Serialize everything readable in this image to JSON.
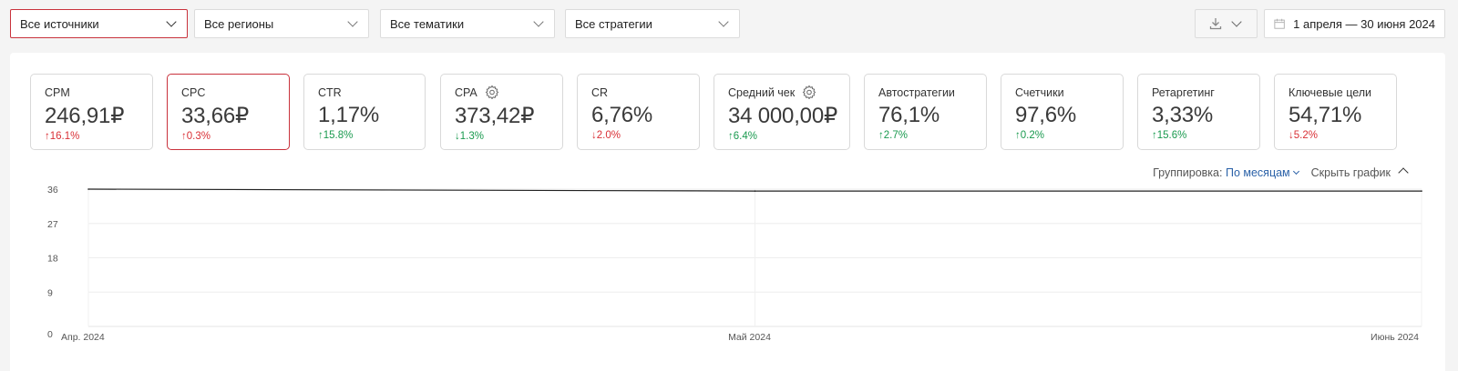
{
  "filters": [
    {
      "label": "Все источники"
    },
    {
      "label": "Все регионы"
    },
    {
      "label": "Все тематики"
    },
    {
      "label": "Все стратегии"
    }
  ],
  "date_range": "1 апреля — 30 июня 2024",
  "metrics": [
    {
      "name": "CPM",
      "value": "246,91₽",
      "delta": "16.1%",
      "dir": "up",
      "color": "down",
      "gear": false
    },
    {
      "name": "CPC",
      "value": "33,66₽",
      "delta": "0.3%",
      "dir": "up",
      "color": "down",
      "gear": false
    },
    {
      "name": "CTR",
      "value": "1,17%",
      "delta": "15.8%",
      "dir": "up",
      "color": "up",
      "gear": false
    },
    {
      "name": "CPA",
      "value": "373,42₽",
      "delta": "1.3%",
      "dir": "down",
      "color": "up",
      "gear": true
    },
    {
      "name": "CR",
      "value": "6,76%",
      "delta": "2.0%",
      "dir": "down",
      "color": "down",
      "gear": false
    },
    {
      "name": "Средний чек",
      "value": "34 000,00₽",
      "delta": "6.4%",
      "dir": "up",
      "color": "up",
      "gear": true
    },
    {
      "name": "Автостратегии",
      "value": "76,1%",
      "delta": "2.7%",
      "dir": "up",
      "color": "up",
      "gear": false
    },
    {
      "name": "Счетчики",
      "value": "97,6%",
      "delta": "0.2%",
      "dir": "up",
      "color": "up",
      "gear": false
    },
    {
      "name": "Ретаргетинг",
      "value": "3,33%",
      "delta": "15.6%",
      "dir": "up",
      "color": "up",
      "gear": false
    },
    {
      "name": "Ключевые цели",
      "value": "54,71%",
      "delta": "5.2%",
      "dir": "down",
      "color": "down",
      "gear": false
    }
  ],
  "grouping": {
    "label": "Группировка:",
    "value": "По месяцам"
  },
  "hide_chart": "Скрыть график",
  "chart_data": {
    "type": "line",
    "x": [
      "Апр. 2024",
      "Май 2024",
      "Июнь 2024"
    ],
    "series": [
      {
        "values": [
          36.0,
          35.5,
          35.5
        ]
      }
    ],
    "yticks": [
      0,
      9,
      18,
      27,
      36
    ],
    "ylim": [
      0,
      36
    ],
    "grid": true
  },
  "colors": {
    "accent": "#c9323c",
    "up": "#1a9a4f",
    "down": "#d93036",
    "link": "#2b62a8"
  }
}
